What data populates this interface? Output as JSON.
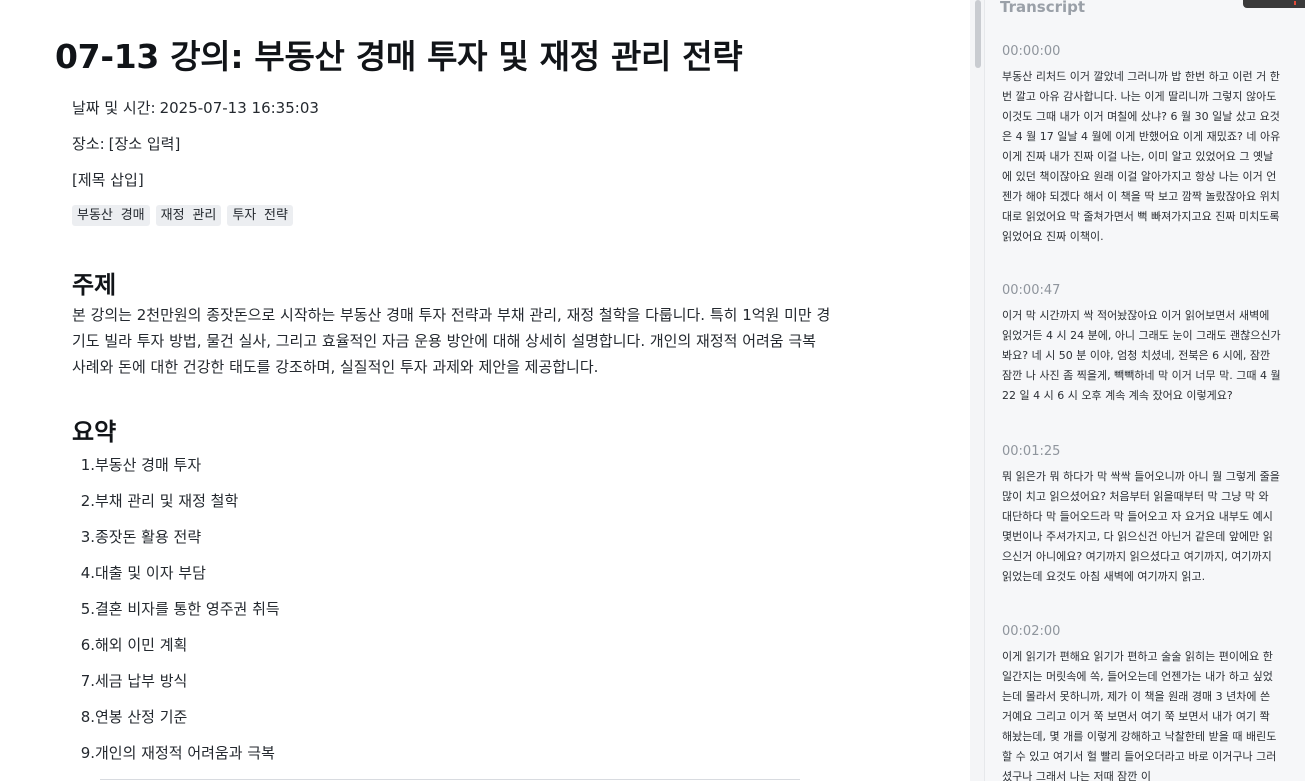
{
  "doc": {
    "title": "07-13 강의: 부동산 경매 투자 및 재정 관리 전략",
    "datetime_label": "날짜 및 시간:",
    "datetime_value": "2025-07-13 16:35:03",
    "location_label": "장소:",
    "location_value": "[장소 입력]",
    "title_placeholder": "[제목 삽입]",
    "tags": [
      "부동산 경매",
      "재정 관리",
      "투자 전략"
    ],
    "topic_heading": "주제",
    "topic_text": "본 강의는 2천만원의 종잣돈으로 시작하는 부동산 경매 투자 전략과 부채 관리, 재정 철학을 다룹니다. 특히 1억원 미만 경기도 빌라 투자 방법, 물건 실사, 그리고 효율적인 자금 운용 방안에 대해 상세히 설명합니다. 개인의 재정적 어려움 극복 사례와 돈에 대한 건강한 태도를 강조하며, 실질적인 투자 과제와 제안을 제공합니다.",
    "summary_heading": "요약",
    "summary_items": [
      "부동산 경매 투자",
      "부채 관리 및 재정 철학",
      "종잣돈 활용 전략",
      "대출 및 이자 부담",
      "결혼 비자를 통한 영주권 취득",
      "해외 이민 계획",
      "세금 납부 방식",
      "연봉 산정 기준",
      "개인의 재정적 어려움과 극복"
    ]
  },
  "transcript": {
    "title": "Transcript",
    "entries": [
      {
        "time": "00:00:00",
        "text": "부동산 리처드 이거 깔았네 그러니까 밥 한번 하고 이런 거 한번 깔고 아유 감사합니다. 나는 이게 딸리니까 그렇지 않아도 이것도 그때 내가 이거 며칠에 샀냐? 6 월 30 일날 샀고 요것은 4 월 17 일날 4 월에 이게 반했어요 이게 재밌죠? 네 아유 이게 진짜 내가 진짜 이걸 나는, 이미 알고 있었어요 그 옛날에 있던 책이잖아요 원래 이걸 알아가지고 항상 나는 이거 언젠가 해야 되겠다 해서 이 책을 딱 보고 깜짝 놀랐잖아요 위치대로 읽었어요 막 줄쳐가면서 뻑 빠져가지고요 진짜 미치도록 읽었어요 진짜 이책이."
      },
      {
        "time": "00:00:47",
        "text": "이거 막 시간까지 싹 적어놨잖아요 이거 읽어보면서 새벽에 읽었거든 4 시 24 분에, 아니 그래도 눈이 그래도 괜찮으신가 봐요? 네 시 50 분 이야, 엄청 치셨네, 전북은 6 시에, 잠깐 잠깐 나 사진 좀 찍을게, 빽빽하네 막 이거 너무 막. 그때 4 월 22 일 4 시 6 시 오후 계속 계속 잤어요 이렇게요?"
      },
      {
        "time": "00:01:25",
        "text": "뭐 읽은가 뭐 하다가 막 싹싹 들어오니까 아니 뭘 그렇게 줄을 많이 치고 읽으셨어요? 처음부터 읽을때부터 막 그냥 막 와 대단하다 막 들어오드라 막 들어오고 자 요거요 내부도 예시 몇번이나 주셔가지고, 다 읽으신건 아닌거 같은데 앞에만 읽으신거 아니에요? 여기까지 읽으셨다고 여기까지, 여기까지 읽었는데 요것도 아침 새벽에 여기까지 읽고."
      },
      {
        "time": "00:02:00",
        "text": "이게 읽기가 편해요 읽기가 편하고 술술 읽히는 편이에요 한 일간지는 머릿속에 쏙, 들어오는데 언젠가는 내가 하고 싶었는데 몰라서 못하니까, 제가 이 책을 원래 경매 3 년차에 쓴 거예요 그리고 이거 쭉 보면서 여기 쭉 보면서 내가 여기 쫙 해놨는데, 몇 개를 이렇게 강해하고 낙찰한테 받을 때 배린도 할 수 있고 여기서 헐 빨리 들어오더라고 바로 이거구나 그러셨구나 그래서 나는 저때 잠깐 이"
      }
    ]
  }
}
